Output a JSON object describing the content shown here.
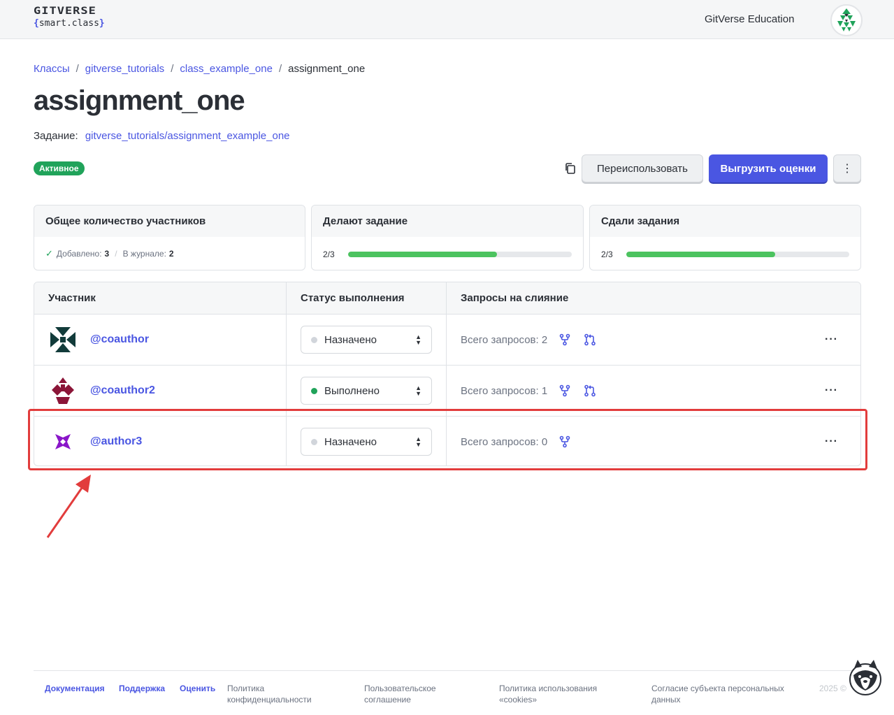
{
  "header": {
    "logo_main": "GITVERSE",
    "logo_sub_open": "{",
    "logo_sub_text": "smart.class",
    "logo_sub_close": "}",
    "org_name": "GitVerse Education"
  },
  "breadcrumb": {
    "items": [
      "Классы",
      "gitverse_tutorials",
      "class_example_one"
    ],
    "separator": "/",
    "current": "assignment_one"
  },
  "page": {
    "title": "assignment_one",
    "assignment_label": "Задание:",
    "assignment_link": "gitverse_tutorials/assignment_example_one",
    "status": "Активное"
  },
  "actions": {
    "reuse_label": "Переиспользовать",
    "export_label": "Выгрузить оценки",
    "more_label": "⋮"
  },
  "stats": {
    "participants": {
      "title": "Общее количество участников",
      "added_label": "Добавлено:",
      "added_value": "3",
      "separator": "/",
      "journal_label": "В журнале:",
      "journal_value": "2"
    },
    "in_progress": {
      "title": "Делают задание",
      "fraction": "2/3",
      "progress": 0.667
    },
    "submitted": {
      "title": "Сдали задания",
      "fraction": "2/3",
      "progress": 0.667
    }
  },
  "table": {
    "headers": [
      "Участник",
      "Статус выполнения",
      "Запросы на слияние"
    ],
    "rows": [
      {
        "user": "@coauthor",
        "status": "Назначено",
        "status_color": "#d1d5db",
        "requests": "Всего запросов: 2",
        "more": "···"
      },
      {
        "user": "@coauthor2",
        "status": "Выполнено",
        "status_color": "#20a35a",
        "requests": "Всего запросов: 1",
        "more": "···"
      },
      {
        "user": "@author3",
        "status": "Назначено",
        "status_color": "#d1d5db",
        "requests": "Всего запросов: 0",
        "more": "···"
      }
    ]
  },
  "footer": {
    "docs": "Документация",
    "support": "Поддержка",
    "rate": "Оценить",
    "privacy_line1": "Политика",
    "privacy_line2": "конфиденциальности",
    "terms_line1": "Пользовательское",
    "terms_line2": "соглашение",
    "cookies_line1": "Политика использования",
    "cookies_line2": "«cookies»",
    "consent_line1": "Согласие субъекта персональных",
    "consent_line2": "данных",
    "year": "2025 ©"
  },
  "colors": {
    "accent": "#4a56e2",
    "success": "#20a35a",
    "progress": "#4cc35f",
    "annotation": "#e23c3c"
  }
}
